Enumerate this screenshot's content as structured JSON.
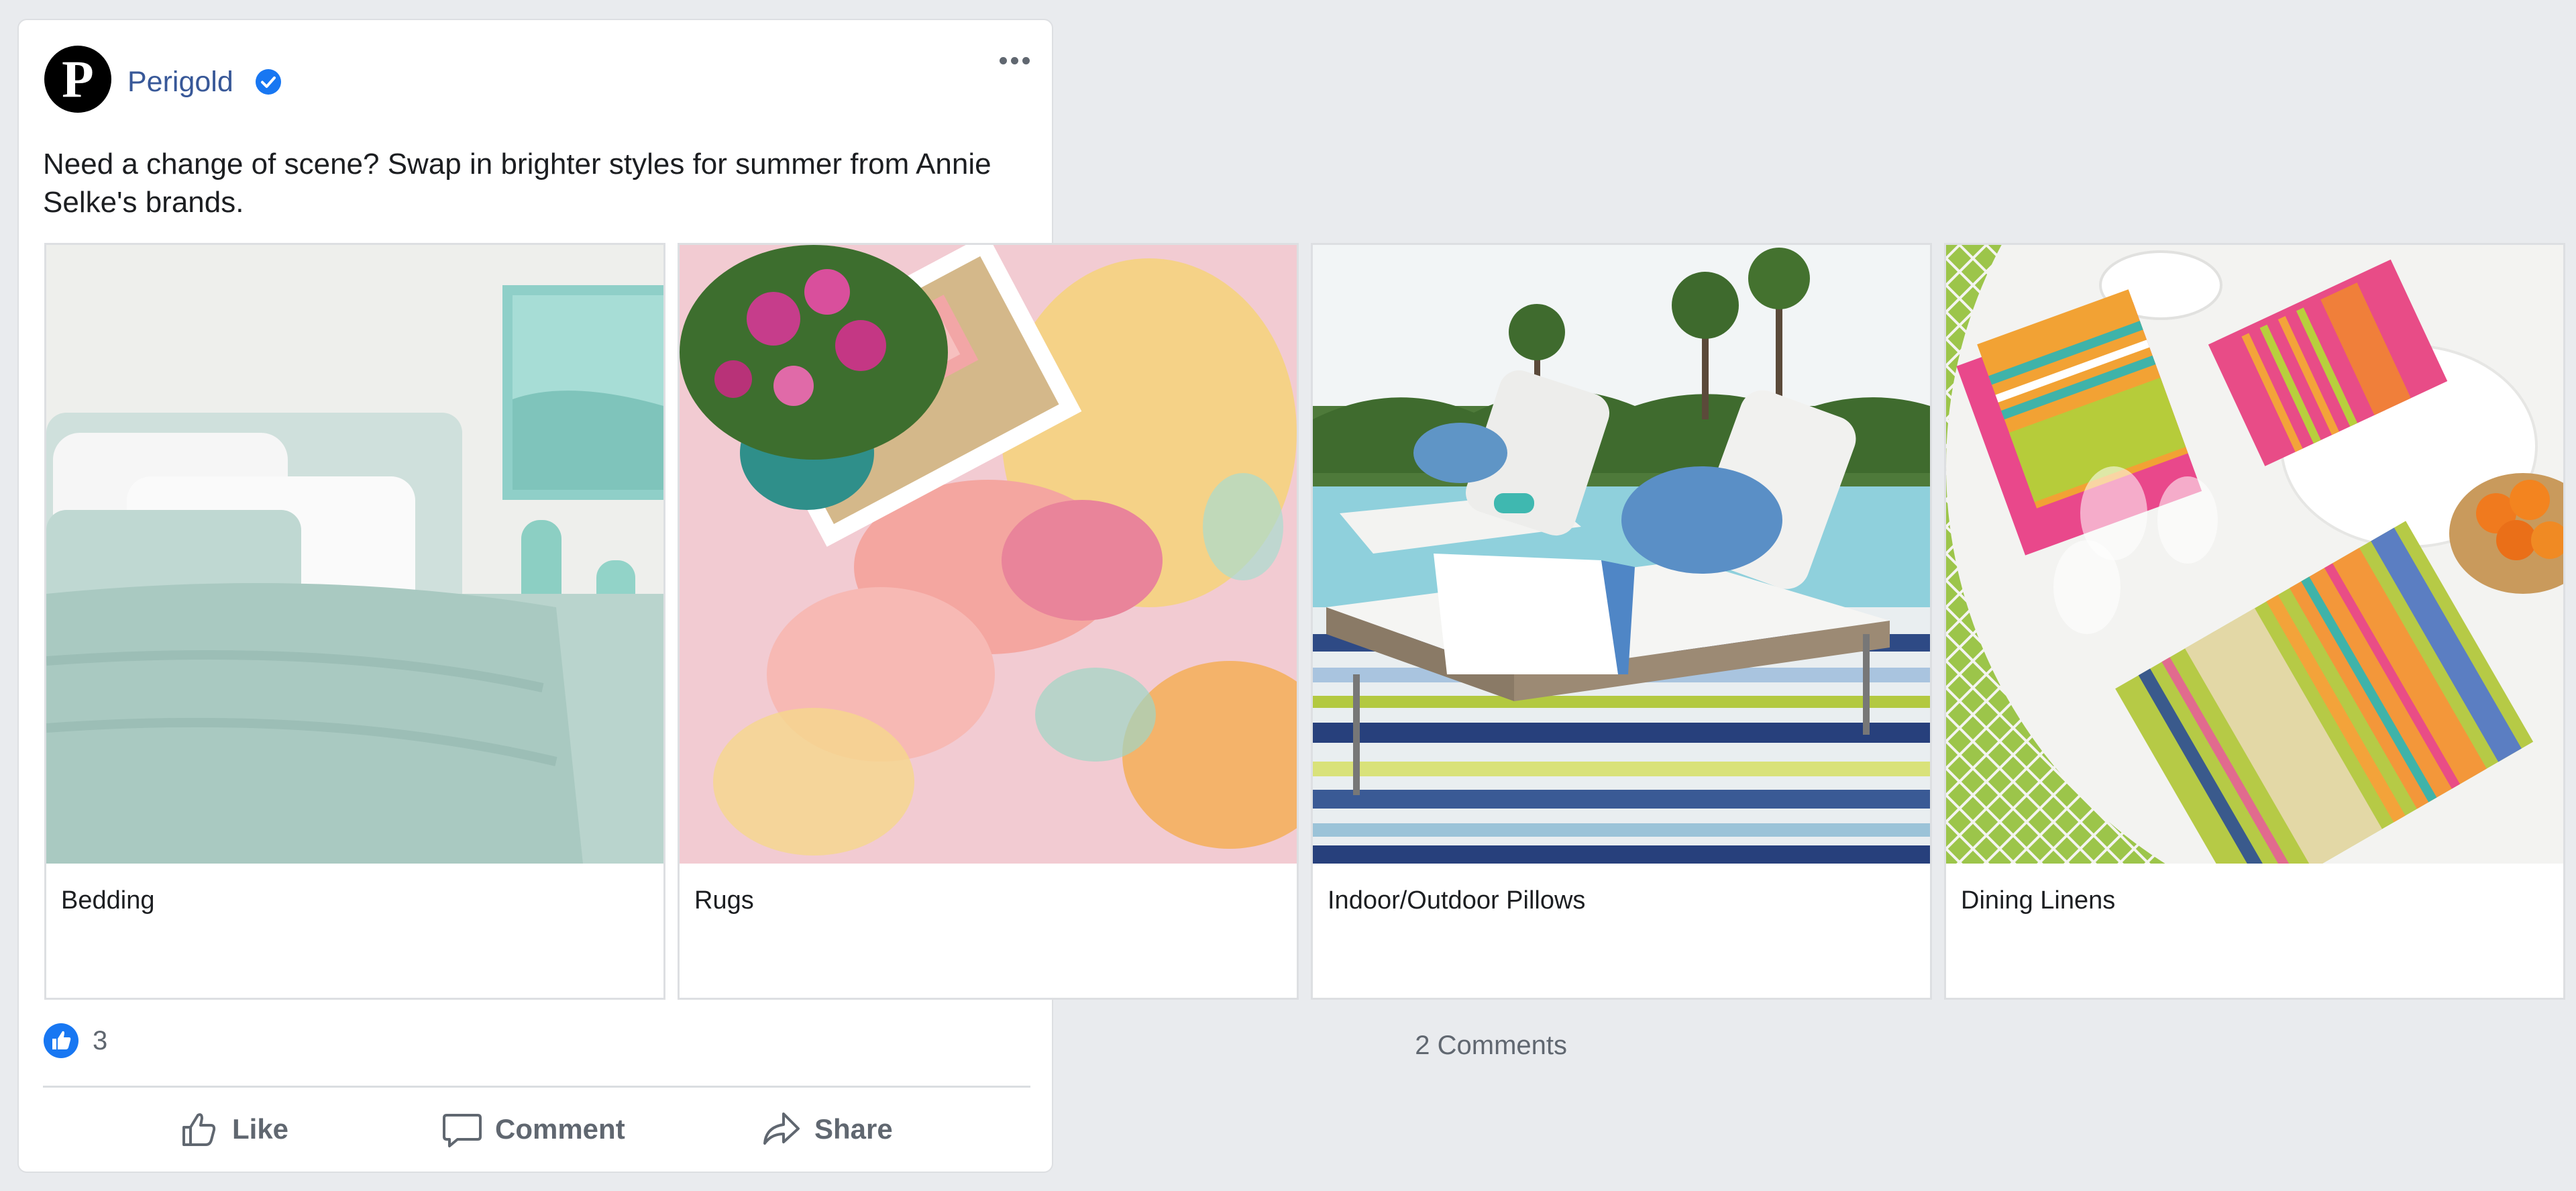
{
  "post": {
    "page_name": "Perigold",
    "avatar_letter": "P",
    "text": "Need a change of scene? Swap in brighter styles for summer from Annie Selke's brands."
  },
  "carousel": [
    {
      "label": "Bedding",
      "image": "teal bedding with white pillows and vases"
    },
    {
      "label": "Rugs",
      "image": "pink watercolor rug with flower pot on tray"
    },
    {
      "label": "Indoor/Outdoor Pillows",
      "image": "outdoor lounge chairs on striped rug by pool"
    },
    {
      "label": "Dining Linens",
      "image": "striped dining linens on white table"
    }
  ],
  "footer": {
    "reaction_count": "3",
    "comments": "2 Comments",
    "like": "Like",
    "comment": "Comment",
    "share": "Share"
  },
  "colors": {
    "link": "#385898",
    "verified": "#1877f2",
    "background": "#e9ebee",
    "muted_text": "#606770"
  },
  "icons": [
    "verified-badge-icon",
    "more-options-icon",
    "like-reaction-icon",
    "thumbs-up-icon",
    "comment-bubble-icon",
    "share-arrow-icon"
  ]
}
